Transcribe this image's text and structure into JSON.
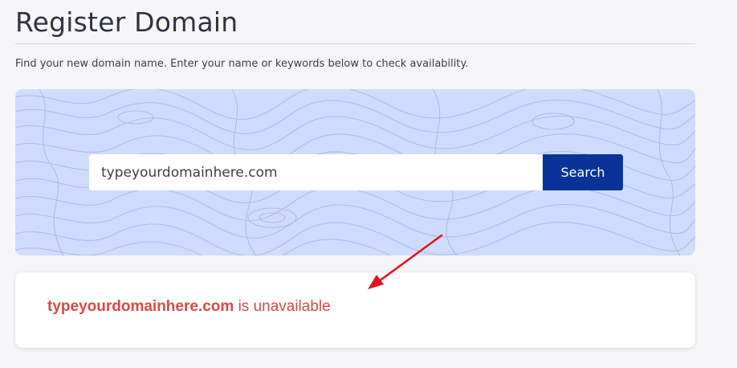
{
  "page": {
    "title": "Register Domain",
    "intro": "Find your new domain name. Enter your name or keywords below to check availability."
  },
  "search": {
    "value": "typeyourdomainhere.com",
    "button_label": "Search"
  },
  "result": {
    "domain": "typeyourdomainhere.com",
    "status_text": "is unavailable"
  },
  "colors": {
    "hero_background": "#d0dcfd",
    "search_button": "#0a3399",
    "unavailable_text": "#d64a48",
    "annotation_arrow": "#e0151e"
  },
  "icons": {
    "annotation": "red-arrow-icon"
  }
}
